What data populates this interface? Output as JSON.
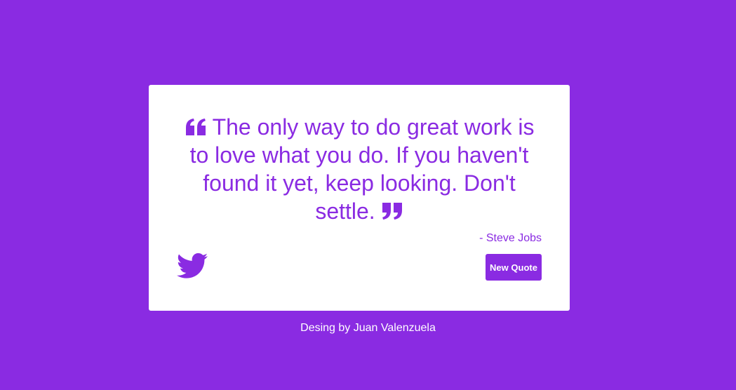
{
  "colors": {
    "background": "#8a2be2",
    "card": "#ffffff",
    "accent": "#8a2be2"
  },
  "quote": {
    "open_icon": "quote-left-icon",
    "text": "The only way to do great work is to love what you do. If you haven't found it yet, keep looking. Don't settle.",
    "close_icon": "quote-right-icon",
    "author": "- Steve Jobs"
  },
  "actions": {
    "tweet_icon": "twitter-icon",
    "new_quote_label": "New Quote"
  },
  "footer": {
    "text": "Desing by Juan Valenzuela"
  }
}
